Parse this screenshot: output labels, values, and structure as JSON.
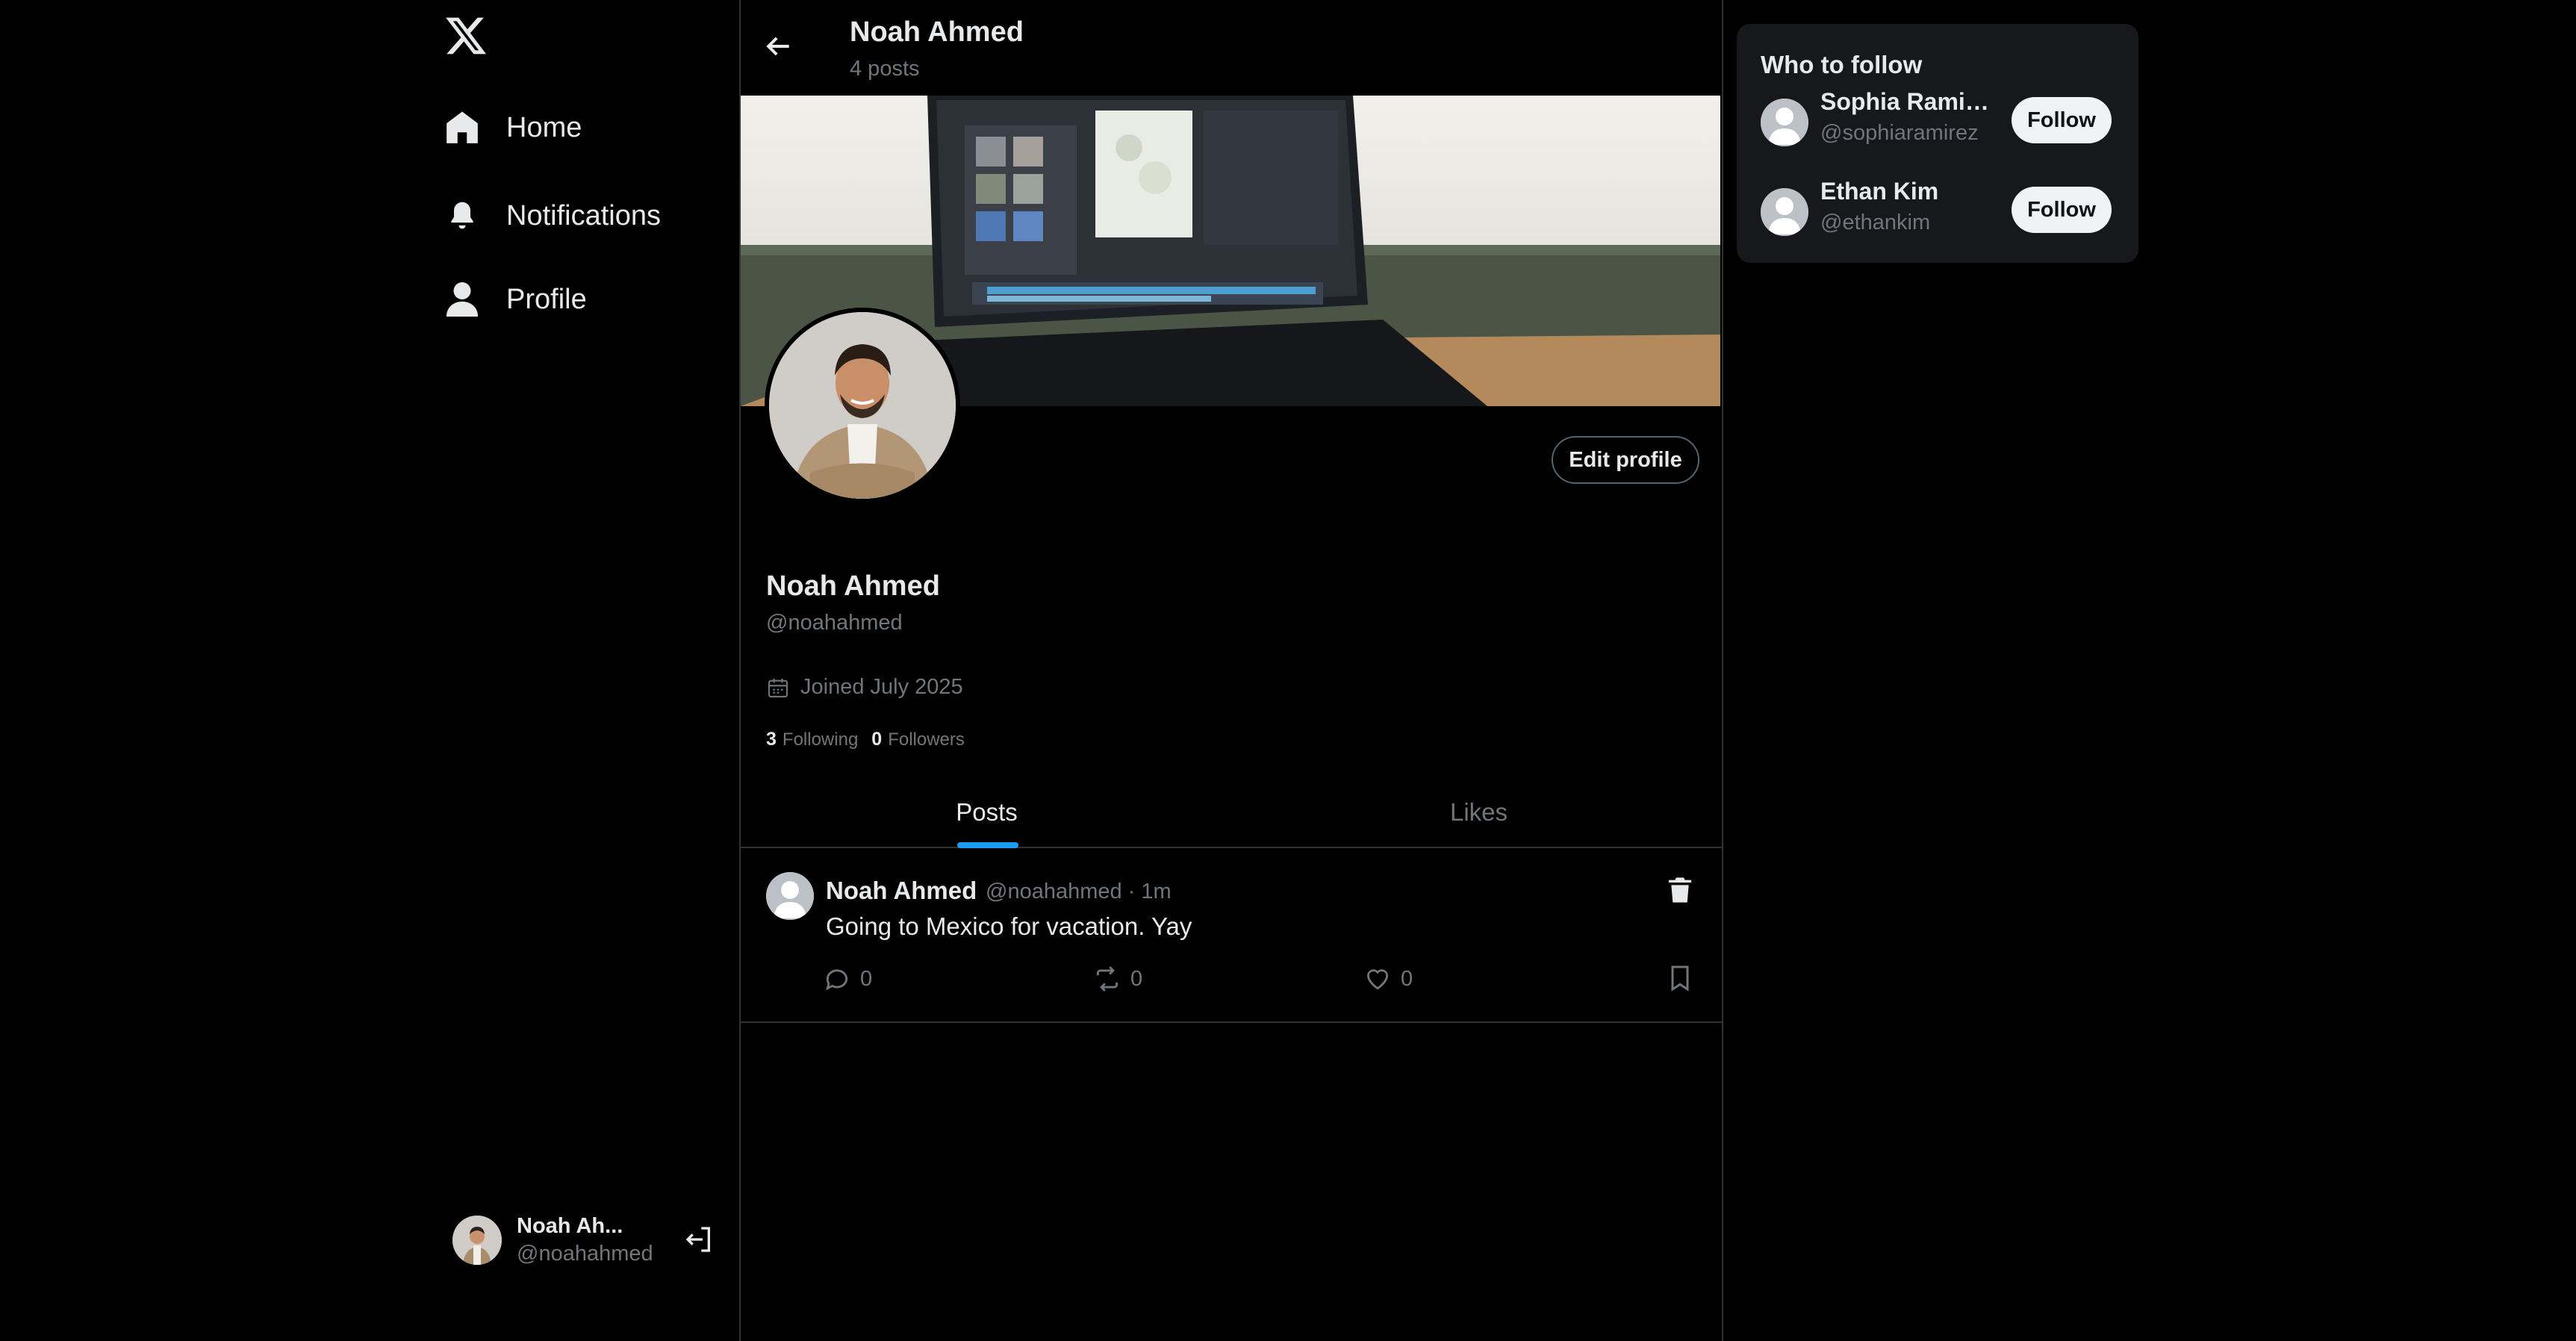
{
  "nav": {
    "logo_icon": "x-logo-icon",
    "items": [
      {
        "label": "Home",
        "icon": "home-icon"
      },
      {
        "label": "Notifications",
        "icon": "bell-icon"
      },
      {
        "label": "Profile",
        "icon": "person-icon"
      }
    ]
  },
  "account": {
    "name": "Noah Ah...",
    "handle": "@noahahmed",
    "logout_icon": "logout-icon"
  },
  "header": {
    "name": "Noah Ahmed",
    "post_count": "4 posts"
  },
  "profile": {
    "name": "Noah Ahmed",
    "handle": "@noahahmed",
    "joined": "Joined July 2025",
    "following_count": "3",
    "following_label": "Following",
    "followers_count": "0",
    "followers_label": "Followers",
    "edit_label": "Edit profile"
  },
  "tabs": [
    {
      "label": "Posts",
      "active": true
    },
    {
      "label": "Likes",
      "active": false
    }
  ],
  "posts": [
    {
      "author": "Noah Ahmed",
      "meta": "@noahahmed · 1m",
      "text": "Going to Mexico for vacation. Yay",
      "replies": "0",
      "reposts": "0",
      "likes": "0"
    }
  ],
  "who_to_follow": {
    "title": "Who to follow",
    "suggestions": [
      {
        "name": "Sophia Ramir...",
        "handle": "@sophiaramirez",
        "button": "Follow"
      },
      {
        "name": "Ethan Kim",
        "handle": "@ethankim",
        "button": "Follow"
      }
    ]
  },
  "colors": {
    "background": "#000000",
    "accent": "#1d9bf0",
    "muted_text": "#71767b",
    "border": "#2f3336",
    "card": "#16181c"
  }
}
